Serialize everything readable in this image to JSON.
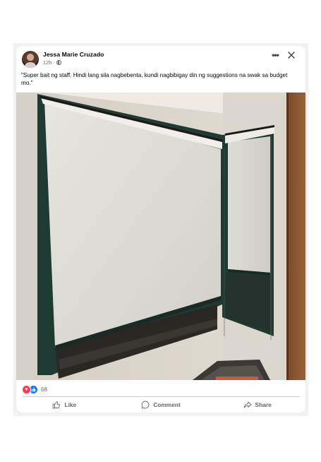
{
  "post": {
    "author": "Jessa Marie Cruzado",
    "time": "12h",
    "separator": "·",
    "caption": "\"Super bait ng staff. Hindi lang sila nagbebenta, kundi nagbibigay din ng suggestions na swak sa budget mo.\"",
    "reaction_count": "68"
  },
  "header_icons": {
    "more": "more-icon",
    "close": "close-icon",
    "audience": "globe-icon"
  },
  "reactions": [
    "love-reaction-icon",
    "like-reaction-icon"
  ],
  "actions": {
    "like": "Like",
    "comment": "Comment",
    "share": "Share"
  },
  "colors": {
    "like_blue": "#1877f2",
    "love_red": "#f33e58",
    "muted_text": "#65676b",
    "blind_frame_green": "#1f3b34"
  }
}
